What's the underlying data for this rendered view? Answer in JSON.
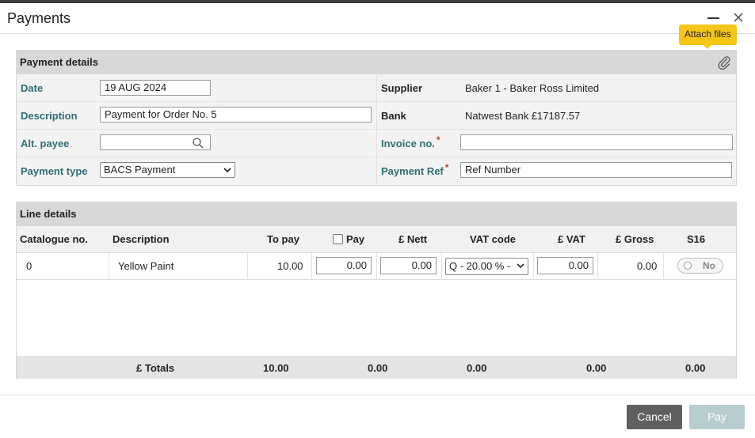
{
  "window": {
    "title": "Payments",
    "tooltip": "Attach files"
  },
  "payment_details": {
    "header": "Payment details",
    "date_label": "Date",
    "date_value": "19 AUG 2024",
    "description_label": "Description",
    "description_value": "Payment for Order No. 5",
    "alt_payee_label": "Alt. payee",
    "alt_payee_value": "",
    "payment_type_label": "Payment type",
    "payment_type_value": "BACS Payment",
    "supplier_label": "Supplier",
    "supplier_value": "Baker 1 - Baker Ross Limited",
    "bank_label": "Bank",
    "bank_value": "Natwest Bank £17187.57",
    "invoice_label": "Invoice no.",
    "invoice_value": "",
    "payment_ref_label": "Payment Ref",
    "payment_ref_value": "Ref Number",
    "required_mark": "*"
  },
  "line_details": {
    "header": "Line details",
    "columns": {
      "catalogue": "Catalogue no.",
      "description": "Description",
      "to_pay": "To pay",
      "pay": "Pay",
      "nett": "£ Nett",
      "vat_code": "VAT code",
      "vat": "£ VAT",
      "gross": "£ Gross",
      "s16": "S16"
    },
    "rows": [
      {
        "catalogue": "0",
        "description": "Yellow Paint",
        "to_pay": "10.00",
        "pay": "0.00",
        "nett": "0.00",
        "vat_code": "Q - 20.00 % -",
        "vat": "0.00",
        "gross": "0.00",
        "s16": "No"
      }
    ],
    "totals": {
      "label": "£ Totals",
      "to_pay": "10.00",
      "pay": "0.00",
      "nett": "0.00",
      "vat": "0.00",
      "gross": "0.00"
    }
  },
  "footer": {
    "cancel_label": "Cancel",
    "pay_label": "Pay"
  }
}
